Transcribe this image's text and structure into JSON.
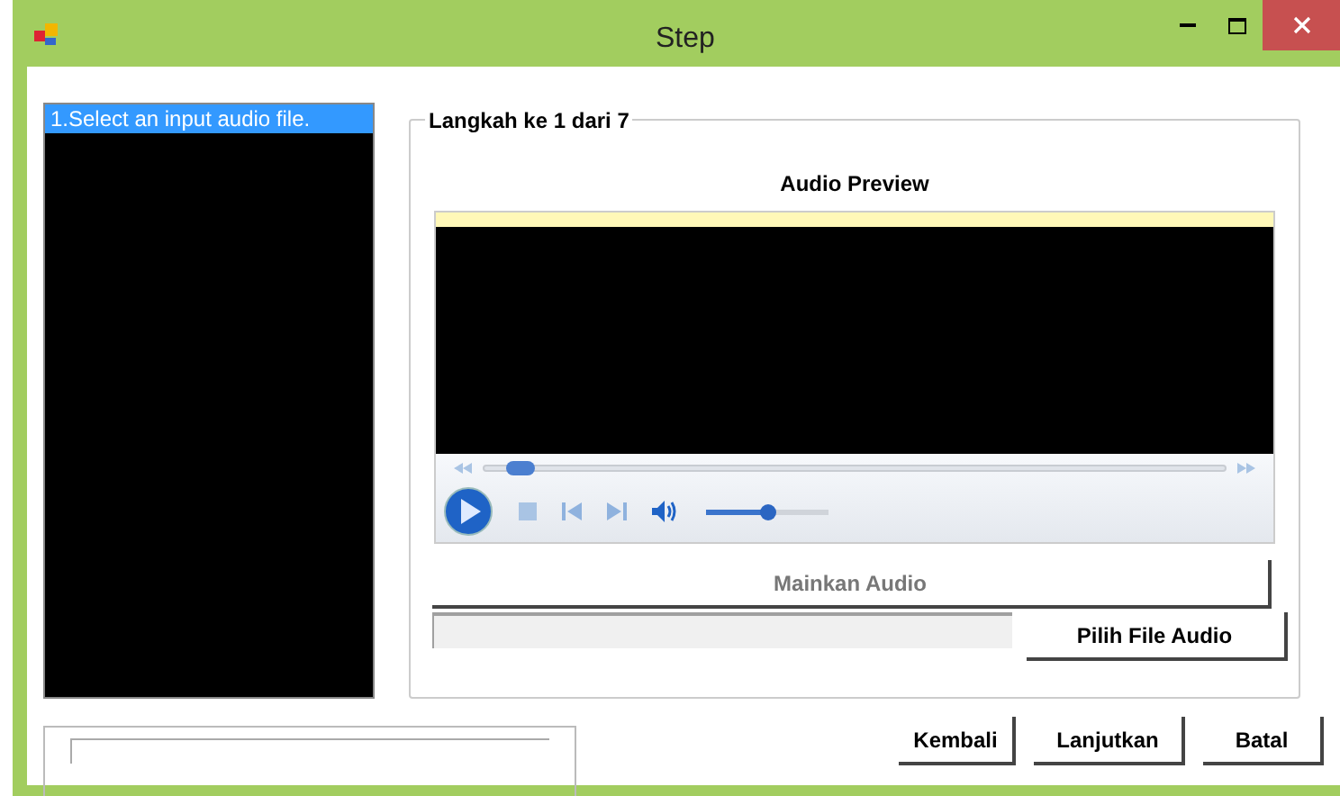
{
  "window": {
    "title": "Step"
  },
  "steps": [
    {
      "label": "1.Select an input audio file.",
      "selected": true
    }
  ],
  "group": {
    "title": "Langkah ke 1 dari 7",
    "heading": "Audio Preview"
  },
  "player": {
    "position": {
      "level": 0.03
    },
    "volume": {
      "level": 0.5
    }
  },
  "play_button": {
    "label": "Mainkan Audio",
    "disabled": true
  },
  "choose_button": {
    "label": "Pilih File Audio"
  },
  "buttons": [
    {
      "label": "Kembali"
    },
    {
      "label": "Lanjutkan"
    },
    {
      "label": "Batal"
    }
  ]
}
